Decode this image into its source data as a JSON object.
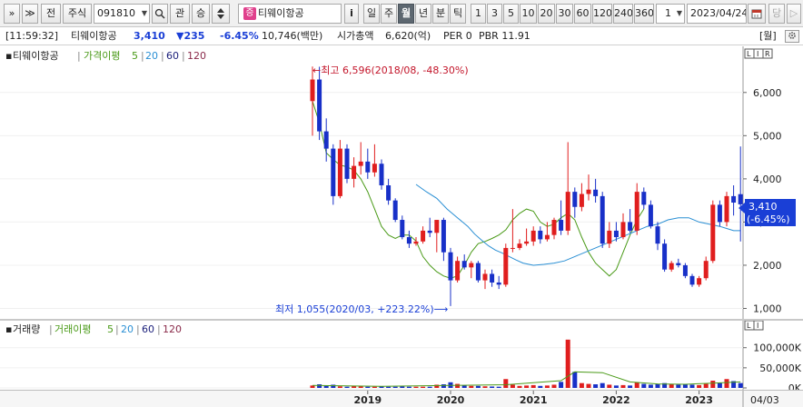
{
  "toolbar": {
    "expand_label": "»",
    "collapse_label": "≫",
    "prev_label": "전",
    "market_label": "주식",
    "code_value": "091810",
    "search_icon": "search-icon",
    "gwan_label": "관",
    "seung_label": "승",
    "stock_badge": "증",
    "stock_name": "티웨이항공",
    "info_label": "i",
    "periods": [
      "일",
      "주",
      "월",
      "년",
      "분",
      "틱"
    ],
    "selected_period": "월",
    "intervals": [
      "1",
      "3",
      "5",
      "10",
      "20",
      "30",
      "60",
      "120",
      "240",
      "360"
    ],
    "count_value": "1",
    "date_value": "2023/04/24",
    "calendar_icon": "calendar-icon",
    "dang_label": "당",
    "scroll_label": "▷"
  },
  "info": {
    "time": "[11:59:32]",
    "name": "티웨이항공",
    "price": "3,410",
    "change": "▼235",
    "change_pct": "-6.45%",
    "volume": "10,746(백만)",
    "market_cap_label": "시가총액",
    "market_cap": "6,620(억)",
    "per": "PER 0",
    "pbr": "PBR 11.91",
    "period_tag": "[월]",
    "settings_icon": "gear-icon"
  },
  "price_panel": {
    "title": "티웨이항공",
    "ma_label": "가격이평",
    "ma_periods": [
      "5",
      "20",
      "60",
      "120"
    ],
    "ctrl_buttons": [
      "L",
      "I",
      "R"
    ],
    "high_note": "←최고 6,596(2018/08, -48.30%)",
    "low_note": "최저 1,055(2020/03, +223.22%)⟶",
    "current_tag_price": "3,410",
    "current_tag_pct": "(-6.45%)",
    "yticks": [
      "6,000",
      "5,000",
      "4,000",
      "3,000",
      "2,000",
      "1,000"
    ]
  },
  "volume_panel": {
    "title": "거래량",
    "ma_label": "거래이평",
    "ma_periods": [
      "5",
      "20",
      "60",
      "120"
    ],
    "ctrl_buttons": [
      "L",
      "I"
    ],
    "yticks": [
      "100,000K",
      "50,000K",
      "0K"
    ]
  },
  "xaxis": {
    "labels": [
      "2019",
      "2020",
      "2021",
      "2022",
      "2023"
    ],
    "last_date": "04/03"
  },
  "colors": {
    "up": "#e01e1e",
    "down": "#1830c8",
    "ma5": "#4a9a18",
    "ma20": "#2a8fd4",
    "ma60": "#1b1f7a",
    "ma120": "#8a2a4a",
    "accent": "#1a3fd6"
  },
  "chart_data": {
    "type": "candlestick",
    "period": "monthly",
    "start": "2018-05",
    "ylim": [
      800,
      6900
    ],
    "volume_ylim": [
      0,
      140000
    ],
    "candles": [
      {
        "o": 5800,
        "h": 6600,
        "l": 5000,
        "c": 6300
      },
      {
        "o": 6300,
        "h": 6596,
        "l": 4900,
        "c": 5100
      },
      {
        "o": 5100,
        "h": 5400,
        "l": 4400,
        "c": 4700
      },
      {
        "o": 4700,
        "h": 4800,
        "l": 3400,
        "c": 3600
      },
      {
        "o": 3600,
        "h": 4900,
        "l": 3550,
        "c": 4700
      },
      {
        "o": 4700,
        "h": 4800,
        "l": 3900,
        "c": 4000
      },
      {
        "o": 4000,
        "h": 4500,
        "l": 3800,
        "c": 4300
      },
      {
        "o": 4300,
        "h": 4850,
        "l": 4100,
        "c": 4400
      },
      {
        "o": 4400,
        "h": 4700,
        "l": 4000,
        "c": 4150
      },
      {
        "o": 4150,
        "h": 4800,
        "l": 4050,
        "c": 4350
      },
      {
        "o": 4350,
        "h": 4450,
        "l": 3750,
        "c": 3850
      },
      {
        "o": 3850,
        "h": 4000,
        "l": 3400,
        "c": 3500
      },
      {
        "o": 3500,
        "h": 3550,
        "l": 3000,
        "c": 3050
      },
      {
        "o": 3050,
        "h": 3150,
        "l": 2600,
        "c": 2650
      },
      {
        "o": 2650,
        "h": 2800,
        "l": 2400,
        "c": 2500
      },
      {
        "o": 2500,
        "h": 2650,
        "l": 2450,
        "c": 2550
      },
      {
        "o": 2550,
        "h": 2900,
        "l": 2500,
        "c": 2800
      },
      {
        "o": 2800,
        "h": 3100,
        "l": 2650,
        "c": 2750
      },
      {
        "o": 2750,
        "h": 3000,
        "l": 2300,
        "c": 3050
      },
      {
        "o": 3050,
        "h": 3100,
        "l": 2100,
        "c": 2300
      },
      {
        "o": 2300,
        "h": 2400,
        "l": 1055,
        "c": 1650
      },
      {
        "o": 1650,
        "h": 2200,
        "l": 1600,
        "c": 2100
      },
      {
        "o": 2100,
        "h": 2250,
        "l": 1900,
        "c": 1950
      },
      {
        "o": 1950,
        "h": 2100,
        "l": 1700,
        "c": 2050
      },
      {
        "o": 2050,
        "h": 2100,
        "l": 1600,
        "c": 1650
      },
      {
        "o": 1650,
        "h": 1900,
        "l": 1450,
        "c": 1800
      },
      {
        "o": 1800,
        "h": 1900,
        "l": 1500,
        "c": 1600
      },
      {
        "o": 1600,
        "h": 1750,
        "l": 1450,
        "c": 1550
      },
      {
        "o": 1550,
        "h": 2500,
        "l": 1500,
        "c": 2400
      },
      {
        "o": 2400,
        "h": 3300,
        "l": 2300,
        "c": 2400
      },
      {
        "o": 2400,
        "h": 2600,
        "l": 2350,
        "c": 2500
      },
      {
        "o": 2500,
        "h": 2850,
        "l": 2450,
        "c": 2550
      },
      {
        "o": 2550,
        "h": 2900,
        "l": 2450,
        "c": 2800
      },
      {
        "o": 2800,
        "h": 2900,
        "l": 2500,
        "c": 2600
      },
      {
        "o": 2600,
        "h": 3000,
        "l": 2550,
        "c": 2700
      },
      {
        "o": 2700,
        "h": 3100,
        "l": 2600,
        "c": 3050
      },
      {
        "o": 3050,
        "h": 3500,
        "l": 2700,
        "c": 2800
      },
      {
        "o": 2800,
        "h": 4850,
        "l": 2700,
        "c": 3700
      },
      {
        "o": 3700,
        "h": 3800,
        "l": 3100,
        "c": 3350
      },
      {
        "o": 3350,
        "h": 3900,
        "l": 3250,
        "c": 3650
      },
      {
        "o": 3650,
        "h": 4100,
        "l": 3500,
        "c": 3750
      },
      {
        "o": 3750,
        "h": 4000,
        "l": 3450,
        "c": 3600
      },
      {
        "o": 3600,
        "h": 3700,
        "l": 2400,
        "c": 2500
      },
      {
        "o": 2500,
        "h": 3000,
        "l": 2400,
        "c": 2800
      },
      {
        "o": 2800,
        "h": 3000,
        "l": 2550,
        "c": 2650
      },
      {
        "o": 2650,
        "h": 3200,
        "l": 2600,
        "c": 3000
      },
      {
        "o": 3000,
        "h": 3300,
        "l": 2750,
        "c": 2800
      },
      {
        "o": 2800,
        "h": 3900,
        "l": 2700,
        "c": 3700
      },
      {
        "o": 3700,
        "h": 3800,
        "l": 3300,
        "c": 3400
      },
      {
        "o": 3400,
        "h": 3500,
        "l": 2850,
        "c": 2900
      },
      {
        "o": 2900,
        "h": 3000,
        "l": 2350,
        "c": 2500
      },
      {
        "o": 2500,
        "h": 2600,
        "l": 1850,
        "c": 1900
      },
      {
        "o": 1900,
        "h": 2100,
        "l": 1850,
        "c": 2050
      },
      {
        "o": 2050,
        "h": 2150,
        "l": 1950,
        "c": 2000
      },
      {
        "o": 2000,
        "h": 2050,
        "l": 1700,
        "c": 1750
      },
      {
        "o": 1750,
        "h": 1800,
        "l": 1500,
        "c": 1550
      },
      {
        "o": 1550,
        "h": 1750,
        "l": 1500,
        "c": 1700
      },
      {
        "o": 1700,
        "h": 2200,
        "l": 1650,
        "c": 2100
      },
      {
        "o": 2100,
        "h": 3500,
        "l": 2050,
        "c": 3400
      },
      {
        "o": 3400,
        "h": 3500,
        "l": 2900,
        "c": 3000
      },
      {
        "o": 3000,
        "h": 3700,
        "l": 2900,
        "c": 3600
      },
      {
        "o": 3600,
        "h": 3850,
        "l": 3150,
        "c": 3450
      },
      {
        "o": 3645,
        "h": 4750,
        "l": 2550,
        "c": 3410
      }
    ],
    "volumes": [
      6000,
      9000,
      5000,
      8000,
      4000,
      3000,
      5000,
      4000,
      3000,
      3000,
      4000,
      3000,
      3000,
      4000,
      3000,
      3000,
      3000,
      3000,
      8000,
      9000,
      14000,
      10000,
      6000,
      5000,
      5000,
      4000,
      3500,
      3000,
      22000,
      8000,
      5000,
      6000,
      7000,
      5000,
      6000,
      8000,
      15000,
      120000,
      40000,
      12000,
      10000,
      9000,
      12000,
      8000,
      6000,
      7000,
      6000,
      14000,
      10000,
      8000,
      9000,
      12000,
      9000,
      8000,
      9000,
      8000,
      7000,
      10000,
      18000,
      12000,
      22000,
      17000,
      12000
    ],
    "ma20": [
      [
        30,
        3870
      ],
      [
        33,
        3700
      ],
      [
        36,
        3550
      ],
      [
        39,
        3300
      ],
      [
        42,
        3100
      ],
      [
        45,
        2900
      ],
      [
        47,
        2720
      ],
      [
        49,
        2580
      ],
      [
        51,
        2450
      ],
      [
        53,
        2350
      ],
      [
        55,
        2280
      ],
      [
        57,
        2200
      ],
      [
        59,
        2120
      ],
      [
        61,
        2050
      ],
      [
        64,
        2000
      ],
      [
        67,
        2020
      ],
      [
        70,
        2050
      ],
      [
        73,
        2100
      ],
      [
        76,
        2200
      ],
      [
        79,
        2300
      ],
      [
        82,
        2400
      ],
      [
        85,
        2500
      ],
      [
        88,
        2600
      ],
      [
        91,
        2700
      ],
      [
        94,
        2800
      ],
      [
        97,
        2900
      ],
      [
        100,
        2950
      ],
      [
        103,
        3050
      ],
      [
        106,
        3100
      ],
      [
        109,
        3100
      ],
      [
        112,
        3000
      ],
      [
        115,
        2950
      ],
      [
        118,
        2900
      ],
      [
        120,
        2850
      ],
      [
        122,
        2800
      ],
      [
        124,
        2800
      ]
    ],
    "ma5": [
      [
        0,
        5800
      ],
      [
        2,
        5300
      ],
      [
        4,
        4600
      ],
      [
        6,
        4450
      ],
      [
        8,
        4320
      ],
      [
        10,
        4280
      ],
      [
        12,
        4200
      ],
      [
        14,
        4000
      ],
      [
        16,
        3700
      ],
      [
        18,
        3300
      ],
      [
        20,
        2900
      ],
      [
        22,
        2700
      ],
      [
        24,
        2620
      ],
      [
        26,
        2700
      ],
      [
        28,
        2700
      ],
      [
        30,
        2560
      ],
      [
        32,
        2200
      ],
      [
        34,
        2000
      ],
      [
        36,
        1850
      ],
      [
        38,
        1750
      ],
      [
        40,
        1700
      ],
      [
        42,
        1750
      ],
      [
        44,
        2000
      ],
      [
        46,
        2300
      ],
      [
        48,
        2500
      ],
      [
        50,
        2550
      ],
      [
        52,
        2620
      ],
      [
        54,
        2700
      ],
      [
        56,
        2820
      ],
      [
        58,
        3050
      ],
      [
        60,
        3200
      ],
      [
        62,
        3300
      ],
      [
        64,
        3250
      ],
      [
        66,
        3000
      ],
      [
        68,
        2900
      ],
      [
        70,
        2950
      ],
      [
        72,
        3100
      ],
      [
        74,
        3200
      ],
      [
        76,
        3050
      ],
      [
        78,
        2650
      ],
      [
        80,
        2300
      ],
      [
        82,
        2050
      ],
      [
        84,
        1900
      ],
      [
        86,
        1750
      ],
      [
        88,
        1900
      ],
      [
        90,
        2300
      ],
      [
        92,
        2700
      ],
      [
        94,
        3050
      ],
      [
        96,
        3300
      ]
    ],
    "volume_ma": [
      [
        0,
        6000
      ],
      [
        10,
        4000
      ],
      [
        20,
        6000
      ],
      [
        28,
        8000
      ],
      [
        36,
        18000
      ],
      [
        38,
        40000
      ],
      [
        42,
        38000
      ],
      [
        46,
        15000
      ],
      [
        50,
        10000
      ],
      [
        54,
        9000
      ],
      [
        58,
        12000
      ],
      [
        62,
        15000
      ]
    ],
    "high": {
      "value": 6596,
      "date": "2018/08"
    },
    "low": {
      "value": 1055,
      "date": "2020/03"
    }
  }
}
